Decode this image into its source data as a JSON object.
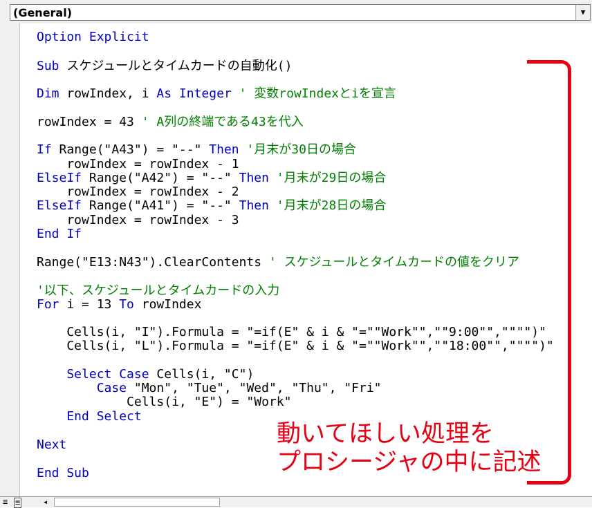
{
  "procedure_dropdown": {
    "selected": "(General)"
  },
  "code_lines": [
    [
      {
        "t": "Option Explicit",
        "c": "kw"
      }
    ],
    [
      {
        "t": "Sub ",
        "c": "kw"
      },
      {
        "t": "スケジュールとタイムカードの自動化()",
        "c": ""
      }
    ],
    [
      {
        "t": "Dim",
        "c": "kw"
      },
      {
        "t": " rowIndex, i ",
        "c": ""
      },
      {
        "t": "As Integer",
        "c": "kw"
      },
      {
        "t": " ' 変数rowIndexとiを宣言",
        "c": "cm"
      }
    ],
    [
      {
        "t": "rowIndex = 43 ",
        "c": ""
      },
      {
        "t": "' A列の終端である43を代入",
        "c": "cm"
      }
    ],
    [
      {
        "t": "If",
        "c": "kw"
      },
      {
        "t": " Range(\"A43\") = \"--\" ",
        "c": ""
      },
      {
        "t": "Then",
        "c": "kw"
      },
      {
        "t": " '月末が30日の場合",
        "c": "cm"
      }
    ],
    [
      {
        "t": "    rowIndex = rowIndex - 1",
        "c": ""
      }
    ],
    [
      {
        "t": "ElseIf",
        "c": "kw"
      },
      {
        "t": " Range(\"A42\") = \"--\" ",
        "c": ""
      },
      {
        "t": "Then",
        "c": "kw"
      },
      {
        "t": " '月末が29日の場合",
        "c": "cm"
      }
    ],
    [
      {
        "t": "    rowIndex = rowIndex - 2",
        "c": ""
      }
    ],
    [
      {
        "t": "ElseIf",
        "c": "kw"
      },
      {
        "t": " Range(\"A41\") = \"--\" ",
        "c": ""
      },
      {
        "t": "Then",
        "c": "kw"
      },
      {
        "t": " '月末が28日の場合",
        "c": "cm"
      }
    ],
    [
      {
        "t": "    rowIndex = rowIndex - 3",
        "c": ""
      }
    ],
    [
      {
        "t": "End If",
        "c": "kw"
      }
    ],
    [
      {
        "t": "Range(\"E13:N43\").ClearContents ",
        "c": ""
      },
      {
        "t": "' スケジュールとタイムカードの値をクリア",
        "c": "cm"
      }
    ],
    [
      {
        "t": "'以下、スケジュールとタイムカードの入力",
        "c": "cm"
      }
    ],
    [
      {
        "t": "For",
        "c": "kw"
      },
      {
        "t": " i = 13 ",
        "c": ""
      },
      {
        "t": "To",
        "c": "kw"
      },
      {
        "t": " rowIndex",
        "c": ""
      }
    ],
    [
      {
        "t": "    Cells(i, \"I\").Formula = \"=if(E\" & i & \"=\"\"Work\"\",\"\"9:00\"\",\"\"\"\")\"",
        "c": ""
      }
    ],
    [
      {
        "t": "    Cells(i, \"L\").Formula = \"=if(E\" & i & \"=\"\"Work\"\",\"\"18:00\"\",\"\"\"\")\"",
        "c": ""
      }
    ],
    [
      {
        "t": "    Select Case",
        "c": "kw"
      },
      {
        "t": " Cells(i, \"C\")",
        "c": ""
      }
    ],
    [
      {
        "t": "        Case",
        "c": "kw"
      },
      {
        "t": " \"Mon\", \"Tue\", \"Wed\", \"Thu\", \"Fri\"",
        "c": ""
      }
    ],
    [
      {
        "t": "            Cells(i, \"E\") = \"Work\"",
        "c": ""
      }
    ],
    [
      {
        "t": "    End Select",
        "c": "kw"
      }
    ],
    [
      {
        "t": "Next",
        "c": "kw"
      }
    ],
    [
      {
        "t": "End Sub",
        "c": "kw"
      }
    ]
  ],
  "annotation": {
    "line1": "動いてほしい処理を",
    "line2": "プロシージャの中に記述",
    "color": "#e60012"
  },
  "colors": {
    "keyword": "#0000c0",
    "comment": "#008000",
    "text": "#000000"
  },
  "bottom_bar": {
    "view_icons": [
      "procedure-view-icon",
      "full-module-view-icon"
    ]
  }
}
